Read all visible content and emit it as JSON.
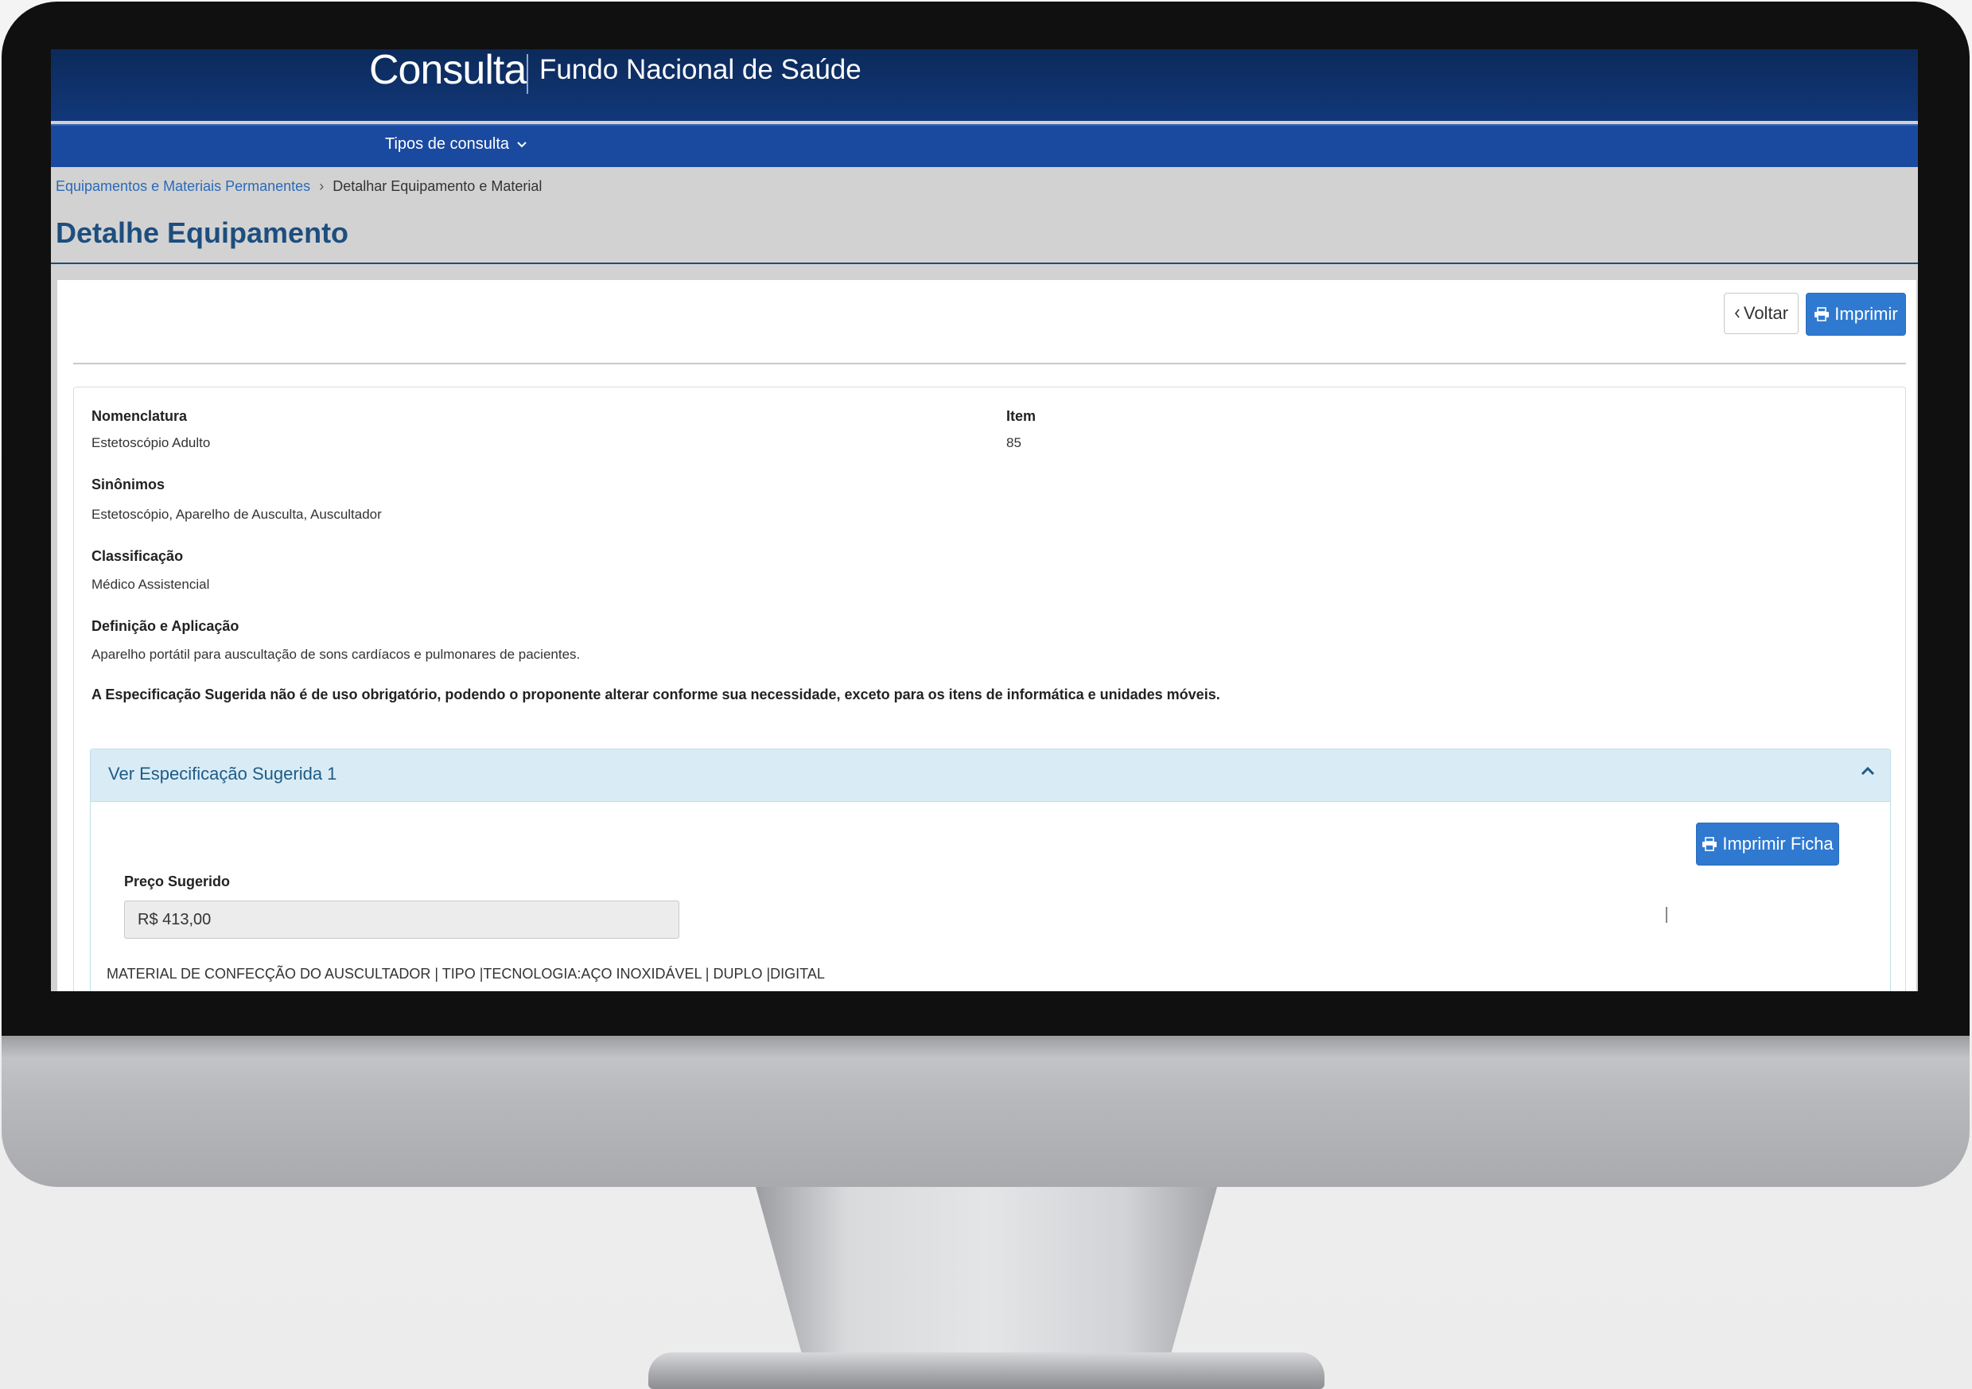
{
  "header": {
    "brand": "Consulta",
    "subtitle": "Fundo Nacional de Saúde"
  },
  "nav": {
    "tipos_label": "Tipos de consulta"
  },
  "breadcrumb": {
    "link": "Equipamentos e Materiais Permanentes",
    "current": "Detalhar Equipamento e Material"
  },
  "page": {
    "title": "Detalhe Equipamento"
  },
  "actions": {
    "voltar": "Voltar",
    "imprimir": "Imprimir"
  },
  "details": {
    "nomenclatura_label": "Nomenclatura",
    "nomenclatura_value": "Estetoscópio Adulto",
    "item_label": "Item",
    "item_value": "85",
    "sinonimos_label": "Sinônimos",
    "sinonimos_value": "Estetoscópio, Aparelho de Ausculta, Auscultador",
    "classificacao_label": "Classificação",
    "classificacao_value": "Médico Assistencial",
    "definicao_label": "Definição e Aplicação",
    "definicao_value": "Aparelho portátil para auscultação de sons cardíacos e pulmonares de pacientes.",
    "notice": "A Especificação Sugerida não é de uso obrigatório, podendo o proponente alterar conforme sua necessidade, exceto para os itens de informática e unidades móveis."
  },
  "spec": {
    "title": "Ver Especificação Sugerida 1",
    "imprimir_ficha": "Imprimir Ficha",
    "preco_label": "Preço Sugerido",
    "preco_value": "R$ 413,00",
    "text": "MATERIAL DE CONFECÇÃO DO AUSCULTADOR | TIPO |TECNOLOGIA:AÇO INOXIDÁVEL | DUPLO |DIGITAL"
  },
  "icons": {
    "chevron_down": "chevron-down-icon",
    "chevron_left": "chevron-left-icon",
    "printer": "printer-icon",
    "chevron_up": "chevron-up-icon"
  },
  "colors": {
    "header_bg": "#0c2a5a",
    "nav_bg": "#1a4aa0",
    "title": "#1d4e7e",
    "primary_button": "#2f7ad0",
    "spec_header_bg": "#d9ecf6"
  }
}
